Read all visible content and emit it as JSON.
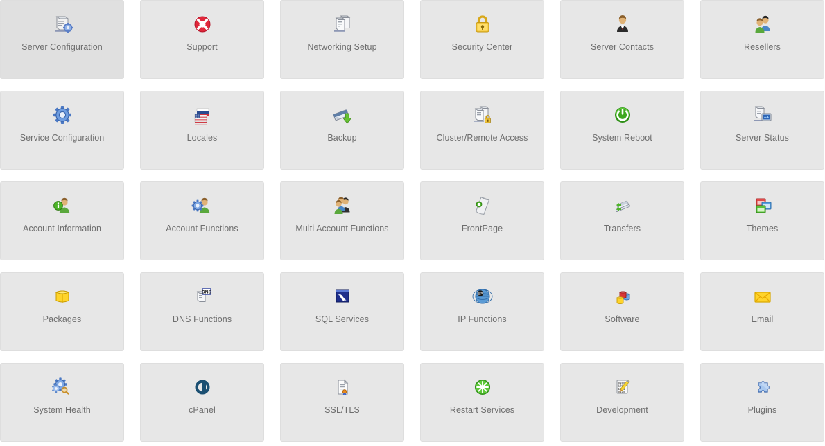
{
  "page": {
    "title": "WHM Home",
    "background_color": "#ffffff",
    "tile_background_color": "#e7e7e7",
    "tile_border_color": "#dedede",
    "label_color": "#6e6e6e",
    "columns": 6,
    "rows": 5
  },
  "tiles": [
    {
      "label": "Server Configuration",
      "icon": "server-gear-icon"
    },
    {
      "label": "Support",
      "icon": "lifebuoy-icon"
    },
    {
      "label": "Networking Setup",
      "icon": "two-servers-icon"
    },
    {
      "label": "Security Center",
      "icon": "padlock-icon"
    },
    {
      "label": "Server Contacts",
      "icon": "person-suit-icon"
    },
    {
      "label": "Resellers",
      "icon": "two-people-icon"
    },
    {
      "label": "Service Configuration",
      "icon": "blue-gear-icon"
    },
    {
      "label": "Locales",
      "icon": "flags-icon"
    },
    {
      "label": "Backup",
      "icon": "tape-download-icon"
    },
    {
      "label": "Cluster/Remote Access",
      "icon": "servers-lock-icon"
    },
    {
      "label": "System Reboot",
      "icon": "green-power-icon"
    },
    {
      "label": "Server Status",
      "icon": "server-monitor-icon"
    },
    {
      "label": "Account Information",
      "icon": "person-info-icon"
    },
    {
      "label": "Account Functions",
      "icon": "person-gear-icon"
    },
    {
      "label": "Multi Account Functions",
      "icon": "three-people-icon"
    },
    {
      "label": "FrontPage",
      "icon": "frontpage-page-icon"
    },
    {
      "label": "Transfers",
      "icon": "transfer-plug-icon"
    },
    {
      "label": "Themes",
      "icon": "windows-stack-icon"
    },
    {
      "label": "Packages",
      "icon": "yellow-box-icon"
    },
    {
      "label": "DNS Functions",
      "icon": "dns-server-icon"
    },
    {
      "label": "SQL Services",
      "icon": "mysql-dolphin-icon"
    },
    {
      "label": "IP Functions",
      "icon": "globe-ip-icon"
    },
    {
      "label": "Software",
      "icon": "colored-blocks-icon"
    },
    {
      "label": "Email",
      "icon": "envelope-icon"
    },
    {
      "label": "System Health",
      "icon": "gears-magnifier-icon"
    },
    {
      "label": "cPanel",
      "icon": "cpanel-logo-icon"
    },
    {
      "label": "SSL/TLS",
      "icon": "certificate-icon"
    },
    {
      "label": "Restart Services",
      "icon": "green-burst-icon"
    },
    {
      "label": "Development",
      "icon": "code-pencil-icon"
    },
    {
      "label": "Plugins",
      "icon": "puzzle-piece-icon"
    }
  ]
}
